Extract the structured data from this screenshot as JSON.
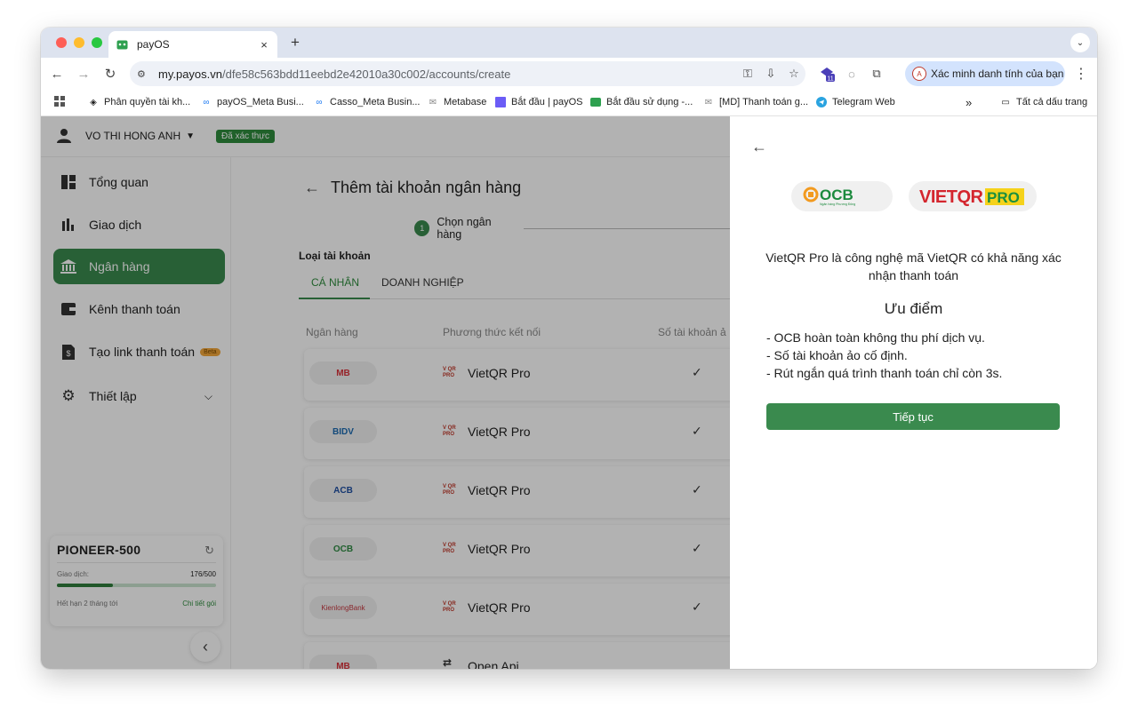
{
  "browser": {
    "tab_title": "payOS",
    "new_tab": "+",
    "tab_close": "×",
    "url_host": "my.payos.vn",
    "url_path": "/dfe58c563bdd11eebd2e42010a30c002/accounts/create",
    "ext_badge": "11",
    "profile_label": "Xác minh danh tính của bạn",
    "profile_initial": "A",
    "overflow": "»",
    "all_bookmarks": "Tất cả dấu trang"
  },
  "bookmarks": [
    {
      "label": "Phân quyền tài kh...",
      "icon": "stack-icon"
    },
    {
      "label": "payOS_Meta Busi...",
      "icon": "meta-icon"
    },
    {
      "label": "Casso_Meta Busin...",
      "icon": "meta-icon"
    },
    {
      "label": "Metabase",
      "icon": "mail-icon"
    },
    {
      "label": "Bắt đầu | payOS",
      "icon": "purple-square-icon"
    },
    {
      "label": "Bắt đầu sử dụng -...",
      "icon": "payos-icon"
    },
    {
      "label": "[MD] Thanh toán g...",
      "icon": "mail-icon"
    },
    {
      "label": "Telegram Web",
      "icon": "telegram-icon"
    }
  ],
  "header": {
    "user_name": "VO THI HONG ANH",
    "verified": "Đã xác thực"
  },
  "sidebar": {
    "items": [
      {
        "label": "Tổng quan",
        "icon": "dashboard-icon"
      },
      {
        "label": "Giao dịch",
        "icon": "bar-chart-icon"
      },
      {
        "label": "Ngân hàng",
        "icon": "bank-icon"
      },
      {
        "label": "Kênh thanh toán",
        "icon": "wallet-icon"
      },
      {
        "label": "Tạo link thanh toán",
        "icon": "invoice-icon",
        "badge": "Beta"
      },
      {
        "label": "Thiết lập",
        "icon": "gear-icon"
      }
    ],
    "plan": {
      "name": "PIONEER-500",
      "tx_label": "Giao dịch:",
      "tx_value": "176/500",
      "tx_used": 176,
      "tx_total": 500,
      "expiry": "Hết hạn 2 tháng tới",
      "detail_link": "Chi tiết gói"
    }
  },
  "main": {
    "title": "Thêm tài khoản ngân hàng",
    "step_number": "1",
    "step_label": "Chọn ngân hàng",
    "account_type_label": "Loại tài khoản",
    "tabs": [
      "CÁ NHÂN",
      "DOANH NGHIỆP"
    ],
    "columns": [
      "Ngân hàng",
      "Phương thức kết nối",
      "Số tài khoản ả"
    ],
    "rows": [
      {
        "bank": "MB",
        "method": "VietQR Pro",
        "check": "✓",
        "color": "#d8323a"
      },
      {
        "bank": "BIDV",
        "method": "VietQR Pro",
        "check": "✓",
        "color": "#1c6ab0"
      },
      {
        "bank": "ACB",
        "method": "VietQR Pro",
        "check": "✓",
        "color": "#1f4fa3"
      },
      {
        "bank": "OCB",
        "method": "VietQR Pro",
        "check": "✓",
        "color": "#2f8a43"
      },
      {
        "bank": "KienlongBank",
        "method": "VietQR Pro",
        "check": "✓",
        "color": "#c4373f"
      },
      {
        "bank": "MB",
        "method": "Open Api",
        "check": "",
        "color": "#d8323a"
      }
    ]
  },
  "drawer": {
    "logo_ocb": "OCB",
    "logo_ocb_sub": "Ngân hàng Phương Đông",
    "logo_vietqr": "VIETQR",
    "logo_pro": "PRO",
    "description": "VietQR Pro là công nghệ mã VietQR có khả năng xác nhận thanh toán",
    "advantages_title": "Ưu điểm",
    "advantages": [
      "- OCB hoàn toàn không thu phí dịch vụ.",
      "- Số tài khoản ảo cố định.",
      "- Rút ngắn quá trình thanh toán chỉ còn 3s."
    ],
    "cta": "Tiếp tục"
  },
  "colors": {
    "primary_green": "#3a8a4e",
    "overlay": "rgba(0,0,0,0.30)"
  }
}
